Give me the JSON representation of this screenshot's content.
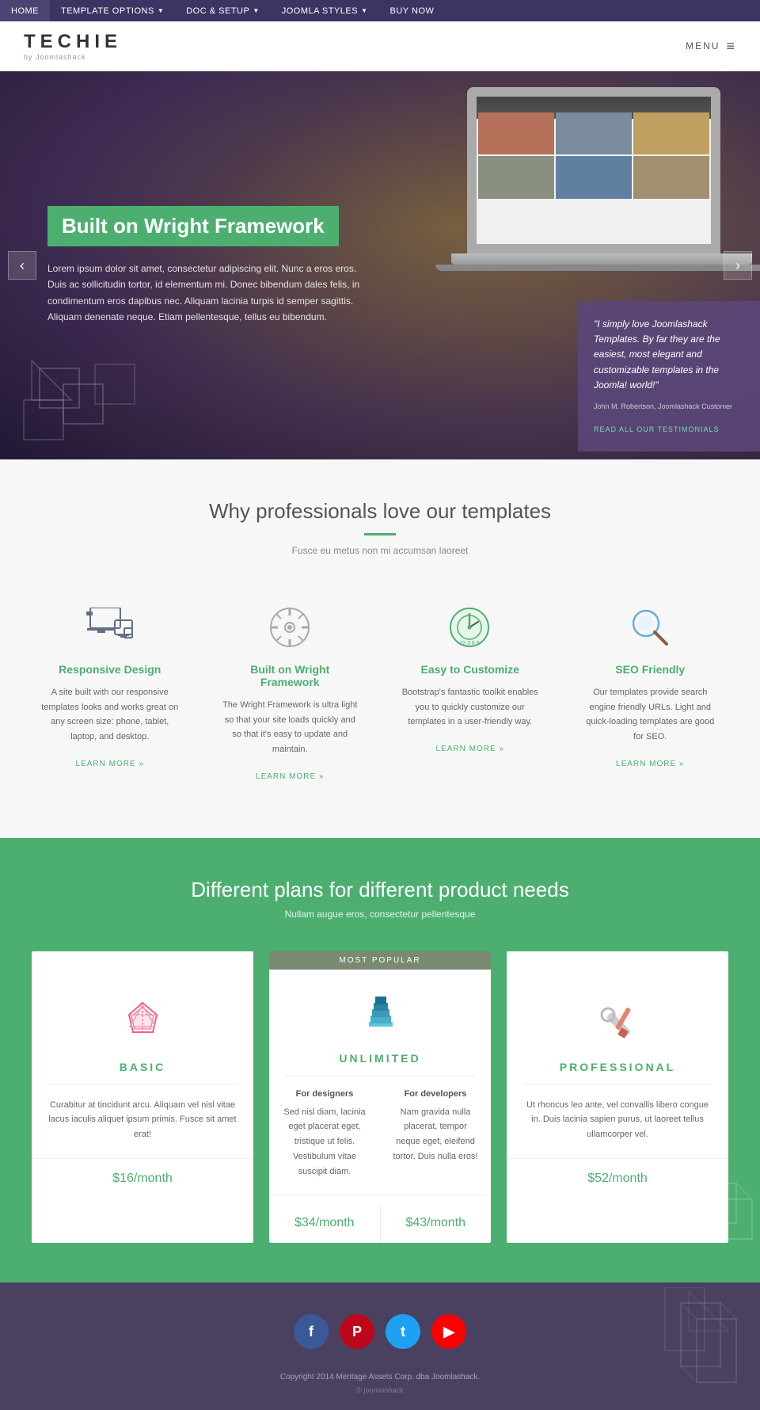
{
  "nav": {
    "items": [
      {
        "label": "HOME",
        "active": true,
        "hasArrow": false
      },
      {
        "label": "TEMPLATE OPTIONS",
        "active": false,
        "hasArrow": true
      },
      {
        "label": "DOC & SETUP",
        "active": false,
        "hasArrow": true
      },
      {
        "label": "JOOMLA STYLES",
        "active": false,
        "hasArrow": true
      },
      {
        "label": "BUY NOW",
        "active": false,
        "hasArrow": false
      }
    ]
  },
  "header": {
    "logo": "TECHIE",
    "logo_by": "by Joomlashack",
    "menu_label": "MENU"
  },
  "hero": {
    "title": "Built on Wright Framework",
    "text": "Lorem ipsum dolor sit amet, consectetur adipiscing elit. Nunc a eros eros. Duis ac sollicitudin tortor, id elementum mi. Donec bibendum dales felis, in condimentum eros dapibus nec. Aliquam lacinia turpis id semper sagittis. Aliquam denenate neque. Etiam pellentesque, tellus eu bibendum.",
    "prev_label": "‹",
    "next_label": "›"
  },
  "testimonial": {
    "quote": "\"I simply love Joomlashack Templates. By far they are the easiest, most elegant and customizable templates in the Joomla! world!\"",
    "author": "John M. Robertson, Joomlashack Customer",
    "link_label": "READ ALL OUR TESTIMONIALS"
  },
  "why": {
    "title": "Why professionals love our templates",
    "divider_color": "#4caf70",
    "subtitle": "Fusce eu metus non mi accumsan laoreet",
    "features": [
      {
        "name": "responsive-design",
        "title": "Responsive Design",
        "desc": "A site built with our responsive templates looks and works great on any screen size: phone, tablet, laptop, and desktop.",
        "link": "LEARN MORE »"
      },
      {
        "name": "wright-framework",
        "title": "Built on Wright Framework",
        "desc": "The Wright Framework is ultra light so that your site loads quickly and so that it's easy to update and maintain.",
        "link": "LEARN MORE »"
      },
      {
        "name": "easy-customize",
        "title": "Easy to Customize",
        "desc": "Bootstrap's fantastic toolkit enables you to quickly customize our templates in a user-friendly way.",
        "link": "LEARN MORE »"
      },
      {
        "name": "seo-friendly",
        "title": "SEO Friendly",
        "desc": "Our templates provide search engine friendly URLs. Light and quick-loading templates are good for SEO.",
        "link": "LEARN MORE »"
      }
    ]
  },
  "plans": {
    "title": "Different plans for different product needs",
    "subtitle": "Nullam augue eros, consectetur pellentesque",
    "most_popular": "MOST POPULAR",
    "items": [
      {
        "name": "BASIC",
        "badge": "",
        "desc": "Curabitur at tincidunt arcu. Aliquam vel nisl vitae lacus iaculis aliquet ipsum primis. Fusce sit amet erat!",
        "price": "$16/month",
        "type": "single"
      },
      {
        "name": "UNLIMITED",
        "badge": "MOST POPULAR",
        "col1_title": "For designers",
        "col1_desc": "Sed nisl diam, lacinia eget placerat eget, tristique ut felis. Vestibulum vitae suscipit diam.",
        "col2_title": "For developers",
        "col2_desc": "Nam gravida nulla placerat, tempor neque eget, eleifend tortor. Duis nulla eros!",
        "price": "$34/month",
        "price2": "$43/month",
        "type": "double"
      },
      {
        "name": "PROFESSIONAL",
        "badge": "",
        "desc": "Ut rhoncus leo ante, vel convallis libero congue in. Duis lacinia sapien purus, ut laoreet tellus ullamcorper vel.",
        "price": "$52/month",
        "type": "single"
      }
    ]
  },
  "footer": {
    "social": [
      {
        "name": "facebook",
        "label": "f",
        "class": "si-facebook"
      },
      {
        "name": "pinterest",
        "label": "P",
        "class": "si-pinterest"
      },
      {
        "name": "twitter",
        "label": "t",
        "class": "si-twitter"
      },
      {
        "name": "youtube",
        "label": "▶",
        "class": "si-youtube"
      }
    ],
    "copyright": "Copyright 2014 Meritage Assets Corp. dba Joomlashack.",
    "logo": "© joomlashack"
  }
}
